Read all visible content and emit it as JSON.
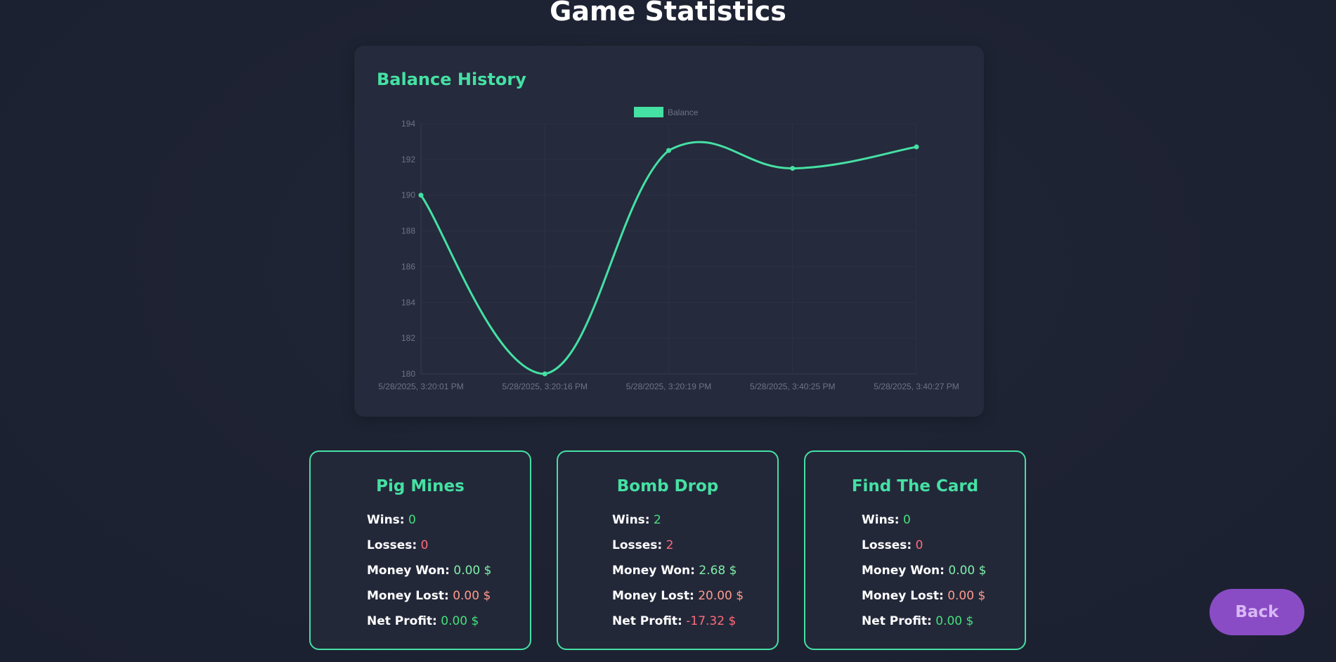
{
  "page": {
    "title": "Game Statistics"
  },
  "chart_section": {
    "title": "Balance History"
  },
  "chart_data": {
    "type": "line",
    "title": "Balance History",
    "legend": [
      "Balance"
    ],
    "legend_position": "top-center",
    "x": [
      "5/28/2025, 3:20:01 PM",
      "5/28/2025, 3:20:16 PM",
      "5/28/2025, 3:20:19 PM",
      "5/28/2025, 3:40:25 PM",
      "5/28/2025, 3:40:27 PM"
    ],
    "series": [
      {
        "name": "Balance",
        "values": [
          190,
          180,
          192.5,
          191.5,
          192.7
        ],
        "color": "#45e0a3"
      }
    ],
    "ylim": [
      180,
      194
    ],
    "yticks": [
      194,
      192,
      190,
      188,
      186,
      184,
      182,
      180
    ],
    "grid": true,
    "smooth": true
  },
  "games": [
    {
      "name": "Pig Mines",
      "wins_label": "Wins:",
      "wins": "0",
      "losses_label": "Losses:",
      "losses": "0",
      "won_label": "Money Won:",
      "won": "0.00 $",
      "lost_label": "Money Lost:",
      "lost": "0.00 $",
      "net_label": "Net Profit:",
      "net": "0.00 $"
    },
    {
      "name": "Bomb Drop",
      "wins_label": "Wins:",
      "wins": "2",
      "losses_label": "Losses:",
      "losses": "2",
      "won_label": "Money Won:",
      "won": "2.68 $",
      "lost_label": "Money Lost:",
      "lost": "20.00 $",
      "net_label": "Net Profit:",
      "net": "-17.32 $"
    },
    {
      "name": "Find The Card",
      "wins_label": "Wins:",
      "wins": "0",
      "losses_label": "Losses:",
      "losses": "0",
      "won_label": "Money Won:",
      "won": "0.00 $",
      "lost_label": "Money Lost:",
      "lost": "0.00 $",
      "net_label": "Net Profit:",
      "net": "0.00 $"
    }
  ],
  "back_button": {
    "label": "Back"
  },
  "colors": {
    "accent": "#45e0a3",
    "positive": "#45e07a",
    "negative": "#ff6b7a",
    "button": "#8a4cc4"
  }
}
